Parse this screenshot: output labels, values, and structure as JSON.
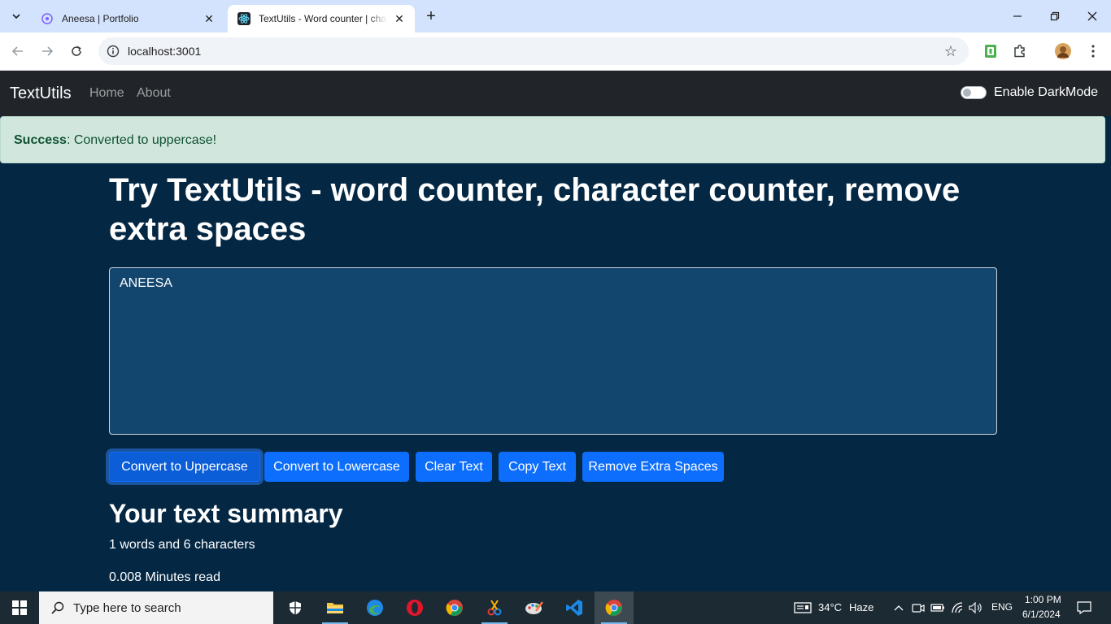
{
  "browser": {
    "tabs": [
      {
        "title": "Aneesa | Portfolio",
        "active": false
      },
      {
        "title": "TextUtils - Word counter | character counter",
        "active": true
      }
    ],
    "url": "localhost:3001"
  },
  "navbar": {
    "brand": "TextUtils",
    "links": [
      "Home",
      "About"
    ],
    "darkmode_label": "Enable DarkMode",
    "darkmode_on": false
  },
  "alert": {
    "type": "Success",
    "message": ": Converted to uppercase!",
    "color": "#d1e7dd"
  },
  "main": {
    "heading": "Try TextUtils - word counter, character counter, remove extra spaces",
    "textarea_value": "ANEESA",
    "buttons": [
      "Convert to Uppercase",
      "Convert to Lowercase",
      "Clear Text",
      "Copy Text",
      "Remove Extra Spaces"
    ],
    "summary_title": "Your text summary",
    "summary_counts": "1 words and 6 characters",
    "summary_read": "0.008 Minutes read",
    "accent": "#0d6efd",
    "background": "#042743"
  },
  "taskbar": {
    "search_placeholder": "Type here to search",
    "weather_temp": "34°C",
    "weather_text": "Haze",
    "language": "ENG",
    "time": "1:00 PM",
    "date": "6/1/2024"
  }
}
